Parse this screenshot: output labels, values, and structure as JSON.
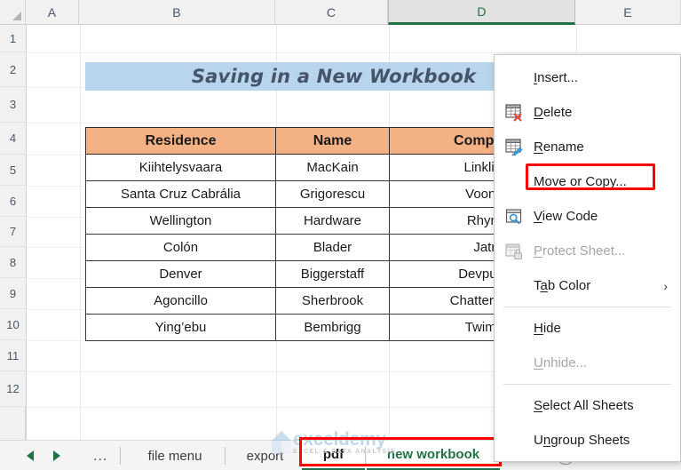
{
  "grid": {
    "columns": [
      "A",
      "B",
      "C",
      "D",
      "E"
    ],
    "selected_column": "D",
    "rows": [
      "1",
      "2",
      "3",
      "4",
      "5",
      "6",
      "7",
      "8",
      "9",
      "10",
      "11",
      "12"
    ]
  },
  "title_banner": {
    "text": "Saving in a New Workbook"
  },
  "table": {
    "headers": [
      "Residence",
      "Name",
      "Company"
    ],
    "rows": [
      [
        "Kiihtelysvaara",
        "MacKain",
        "Linklink"
      ],
      [
        "Santa Cruz Cabrália",
        "Grigorescu",
        "Voonte"
      ],
      [
        "Wellington",
        "Hardware",
        "Rhyno"
      ],
      [
        "Colón",
        "Blader",
        "Jatri"
      ],
      [
        "Denver",
        "Biggerstaff",
        "Devpulse"
      ],
      [
        "Agoncillo",
        "Sherbrook",
        "Chatterpoint"
      ],
      [
        "Ying’ebu",
        "Bembrigg",
        "Twimm"
      ]
    ]
  },
  "context_menu": {
    "items": [
      {
        "label": "Insert...",
        "accel": "I",
        "icon": "none",
        "disabled": false,
        "submenu": false,
        "sep_after": false,
        "highlighted": false
      },
      {
        "label": "Delete",
        "accel": "D",
        "icon": "delete-sheet-icon",
        "disabled": false,
        "submenu": false,
        "sep_after": false,
        "highlighted": false
      },
      {
        "label": "Rename",
        "accel": "R",
        "icon": "rename-sheet-icon",
        "disabled": false,
        "submenu": false,
        "sep_after": false,
        "highlighted": false
      },
      {
        "label": "Move or Copy...",
        "accel": "M",
        "icon": "none",
        "disabled": false,
        "submenu": false,
        "sep_after": false,
        "highlighted": true
      },
      {
        "label": "View Code",
        "accel": "V",
        "icon": "view-code-icon",
        "disabled": false,
        "submenu": false,
        "sep_after": false,
        "highlighted": false
      },
      {
        "label": "Protect Sheet...",
        "accel": "P",
        "icon": "protect-sheet-icon",
        "disabled": true,
        "submenu": false,
        "sep_after": false,
        "highlighted": false
      },
      {
        "label": "Tab Color",
        "accel": "T",
        "icon": "none",
        "disabled": false,
        "submenu": true,
        "sep_after": true,
        "highlighted": false
      },
      {
        "label": "Hide",
        "accel": "H",
        "icon": "none",
        "disabled": false,
        "submenu": false,
        "sep_after": false,
        "highlighted": false
      },
      {
        "label": "Unhide...",
        "accel": "U",
        "icon": "none",
        "disabled": true,
        "submenu": false,
        "sep_after": true,
        "highlighted": false
      },
      {
        "label": "Select All Sheets",
        "accel": "S",
        "icon": "none",
        "disabled": false,
        "submenu": false,
        "sep_after": false,
        "highlighted": false
      },
      {
        "label": "Ungroup Sheets",
        "accel": "n",
        "icon": "none",
        "disabled": false,
        "submenu": false,
        "sep_after": false,
        "highlighted": false
      }
    ],
    "submenu_arrow": "›"
  },
  "tab_bar": {
    "prev_arrow": "◀",
    "next_arrow": "▶",
    "left_ellipsis": "...",
    "tabs": [
      {
        "label": "file menu",
        "state": "normal"
      },
      {
        "label": "export",
        "state": "normal"
      },
      {
        "label": "pdf",
        "state": "current-white"
      },
      {
        "label": "new workbook",
        "state": "active"
      }
    ],
    "right_ellipsis": "...",
    "add_sheet_label": "+",
    "vertical_dots": "⋮"
  },
  "watermark": {
    "name": "exceldemy",
    "subtitle": "EXCEL & DATA ANALYSIS"
  },
  "colors": {
    "banner_fill": "#b9d5ed",
    "banner_text": "#44546a",
    "table_header_fill": "#f4b183",
    "excel_green": "#217346",
    "highlight_red": "#ff0000"
  }
}
